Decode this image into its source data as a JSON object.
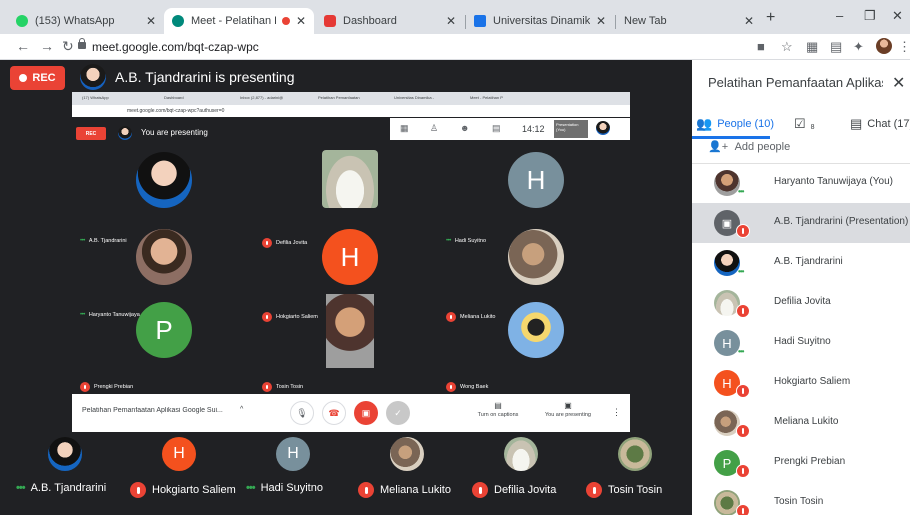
{
  "browser": {
    "tabs": [
      {
        "title": "(153) WhatsApp",
        "color": "#25d366"
      },
      {
        "title": "Meet - Pelatihan Pema",
        "color": "#00897b"
      },
      {
        "title": "Dashboard",
        "color": "#e53935"
      },
      {
        "title": "Universitas Dinamika - Cale",
        "color": "#1a73e8"
      },
      {
        "title": "New Tab",
        "color": ""
      }
    ],
    "new_tab_symbol": "+",
    "url": "meet.google.com/bqt-czap-wpc"
  },
  "meet": {
    "rec_label": "REC",
    "presenting_title": "A.B. Tjandrarini is presenting",
    "shared_screen": {
      "tabs": [
        "(17) WhatsApp",
        "Dashboard",
        "Inbox (2,877) - adarini@",
        "Pelatihan Pemanfaatan",
        "Universitas Dinamika -",
        "Meet - Pelatihan P"
      ],
      "url": "meet.google.com/bqt-czap-wpc?authuser=0",
      "rec_label": "REC",
      "presenting_text": "You are presenting",
      "time": "14:12",
      "thumb_label": "Presentation (You)",
      "you_label": "You",
      "tiles": [
        {
          "name": "A.B. Tjandrarini",
          "status": "active"
        },
        {
          "name": "Defilia Jovita",
          "status": "muted"
        },
        {
          "name": "Hadi Suyitno",
          "status": "active",
          "initial": "H"
        },
        {
          "name": "Haryanto Tanuwijaya",
          "status": "active"
        },
        {
          "name": "Hokgiarto Saliem",
          "status": "muted",
          "initial": "H"
        },
        {
          "name": "Meliana Lukito",
          "status": "muted"
        },
        {
          "name": "Prengki Prebian",
          "status": "muted",
          "initial": "P"
        },
        {
          "name": "Tosin Tosin",
          "status": "muted"
        },
        {
          "name": "Wong Baek",
          "status": "muted"
        }
      ],
      "meeting_name": "Pelatihan Pemanfaatan Aplikasi Google Sui...",
      "captions_label": "Turn on captions",
      "presenting_label": "You are presenting"
    },
    "strip": [
      {
        "name": "A.B. Tjandrarini",
        "status": "active"
      },
      {
        "name": "Hokgiarto Saliem",
        "status": "muted",
        "initial": "H"
      },
      {
        "name": "Hadi Suyitno",
        "status": "active",
        "initial": "H"
      },
      {
        "name": "Meliana Lukito",
        "status": "muted"
      },
      {
        "name": "Defilia Jovita",
        "status": "muted"
      },
      {
        "name": "Tosin Tosin",
        "status": "muted"
      }
    ]
  },
  "panel": {
    "title": "Pelatihan Pemanfaatan Aplikas...",
    "tabs": {
      "people": "People (10)",
      "tasks_count": "8",
      "chat": "Chat (17)"
    },
    "add_people": "Add people",
    "people": [
      {
        "name": "Haryanto Tanuwijaya (You)",
        "status": "active"
      },
      {
        "name": "A.B. Tjandrarini (Presentation)",
        "status": "muted"
      },
      {
        "name": "A.B. Tjandrarini",
        "status": "active"
      },
      {
        "name": "Defilia Jovita",
        "status": "muted"
      },
      {
        "name": "Hadi Suyitno",
        "status": "active",
        "initial": "H"
      },
      {
        "name": "Hokgiarto Saliem",
        "status": "muted",
        "initial": "H"
      },
      {
        "name": "Meliana Lukito",
        "status": "muted"
      },
      {
        "name": "Prengki Prebian",
        "status": "muted",
        "initial": "P"
      },
      {
        "name": "Tosin Tosin",
        "status": "muted"
      }
    ]
  },
  "colors": {
    "accent": "#1a73e8",
    "rec_red": "#ea4335",
    "orange_avatar": "#f4511e",
    "grey_avatar": "#78909c",
    "green_avatar": "#43a047",
    "meet_bg": "#202124"
  }
}
